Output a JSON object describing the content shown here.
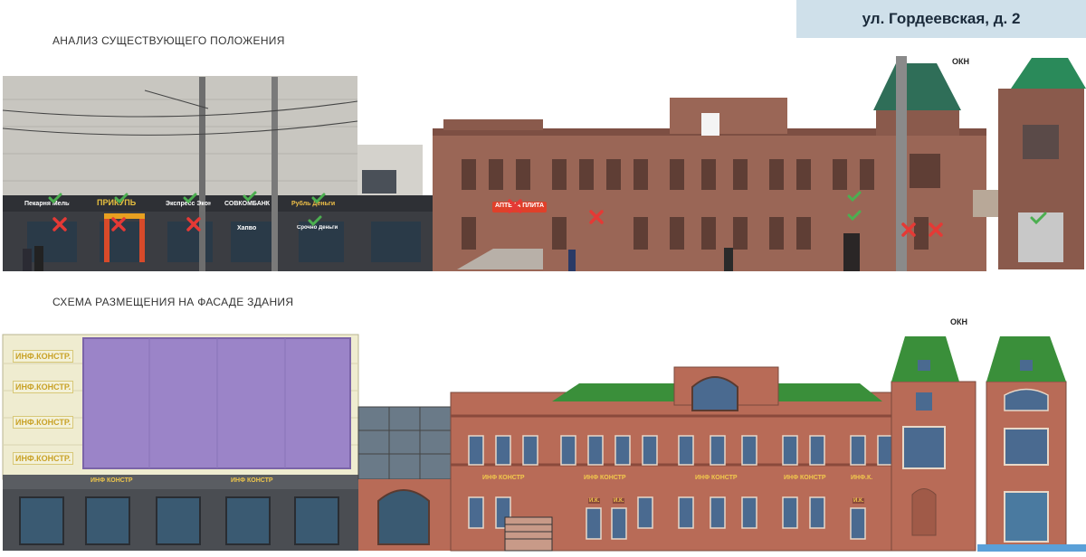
{
  "address": "ул. Гордеевская, д. 2",
  "sections": {
    "analysis_title": "АНАЛИЗ СУЩЕСТВУЮЩЕГО ПОЛОЖЕНИЯ",
    "scheme_title": "СХЕМА РАЗМЕЩЕНИЯ НА ФАСАДЕ ЗДАНИЯ"
  },
  "okn_label": "ОКН",
  "photo_signs": {
    "s1": "Пекарня Мельница",
    "s2": "ПРИКУПЬ",
    "s3": "Экспресс Экономия",
    "s4": "СОВКОМБАНК",
    "s5": "Рубль Деньги",
    "s6": "Хапво",
    "s7": "Срочно Деньги",
    "s8": "АПТЕКА ПЛИТА"
  },
  "scheme_labels": {
    "inf_full": "ИНФ.КОНСТР.",
    "inf_space": "ИНФ КОНСТР",
    "inf_short": "ИНФ.К.",
    "ik": "И.К."
  },
  "colors": {
    "check": "#4caf50",
    "cross": "#e53935",
    "brick": "#b86b57",
    "roof": "#3a8f3a",
    "banner": "#9b84c8"
  }
}
